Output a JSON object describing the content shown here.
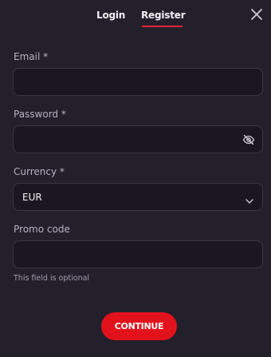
{
  "tabs": {
    "login": "Login",
    "register": "Register",
    "active": "register"
  },
  "form": {
    "email": {
      "label": "Email *",
      "value": "",
      "placeholder": ""
    },
    "password": {
      "label": "Password *",
      "value": "",
      "placeholder": ""
    },
    "currency": {
      "label": "Currency *",
      "selected": "EUR"
    },
    "promo": {
      "label": "Promo code",
      "value": "",
      "placeholder": "",
      "hint": "This field is optional"
    }
  },
  "actions": {
    "continue_label": "CONTINUE"
  },
  "icons": {
    "close": "close-icon",
    "password_toggle": "eye-off-icon",
    "currency_dropdown": "chevron-down-icon"
  },
  "colors": {
    "background": "#231f2b",
    "input_background": "#1a1720",
    "accent": "#e2121c"
  }
}
